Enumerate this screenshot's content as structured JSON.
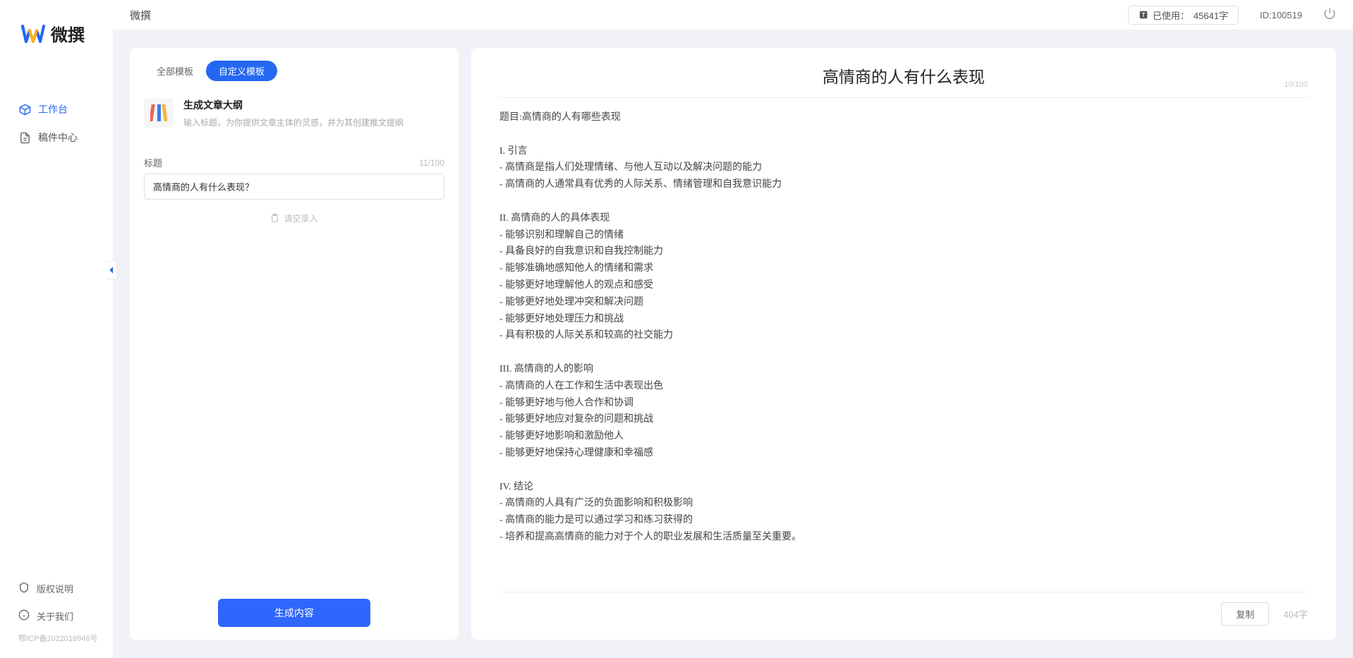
{
  "brand": {
    "name": "微撰"
  },
  "header": {
    "title": "微撰",
    "usage_prefix": "已使用：",
    "usage_value": "45641字",
    "user_id": "ID:100519"
  },
  "sidebar": {
    "items": [
      {
        "label": "工作台"
      },
      {
        "label": "稿件中心"
      }
    ],
    "footer": [
      {
        "label": "版权说明"
      },
      {
        "label": "关于我们"
      }
    ],
    "icp": "鄂ICP备2022016946号"
  },
  "tabs": {
    "all": "全部模板",
    "custom": "自定义模板"
  },
  "template": {
    "title": "生成文章大纲",
    "desc": "输入标题，为你提供文章主体的灵感，并为其创建推文提纲"
  },
  "form": {
    "title_label": "标题",
    "title_count": "11/100",
    "title_value": "高情商的人有什么表现？",
    "hint": "请空录入",
    "generate": "生成内容"
  },
  "output": {
    "title": "高情商的人有什么表现",
    "title_count": "10/100",
    "body": "题目:高情商的人有哪些表现\n\nI. 引言\n- 高情商是指人们处理情绪、与他人互动以及解决问题的能力\n- 高情商的人通常具有优秀的人际关系、情绪管理和自我意识能力\n\nII. 高情商的人的具体表现\n- 能够识别和理解自己的情绪\n- 具备良好的自我意识和自我控制能力\n- 能够准确地感知他人的情绪和需求\n- 能够更好地理解他人的观点和感受\n- 能够更好地处理冲突和解决问题\n- 能够更好地处理压力和挑战\n- 具有积极的人际关系和较高的社交能力\n\nIII. 高情商的人的影响\n- 高情商的人在工作和生活中表现出色\n- 能够更好地与他人合作和协调\n- 能够更好地应对复杂的问题和挑战\n- 能够更好地影响和激励他人\n- 能够更好地保持心理健康和幸福感\n\nIV. 结论\n- 高情商的人具有广泛的负面影响和积极影响\n- 高情商的能力是可以通过学习和练习获得的\n- 培养和提高高情商的能力对于个人的职业发展和生活质量至关重要。",
    "copy": "复制",
    "char_count": "404字"
  }
}
